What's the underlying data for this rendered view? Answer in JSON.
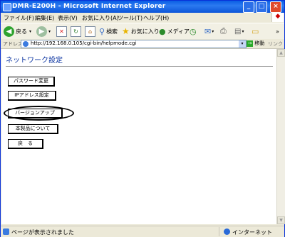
{
  "window": {
    "title": "DMR-E200H - Microsoft Internet Explorer"
  },
  "menu": [
    "ファイル(F)",
    "編集(E)",
    "表示(V)",
    "お気に入り(A)",
    "ツール(T)",
    "ヘルプ(H)"
  ],
  "toolbar": {
    "back": "戻る",
    "search": "検索",
    "favorites": "お気に入り",
    "media": "メディア"
  },
  "address": {
    "label": "アドレス(D)",
    "url": "http://192.168.0.105/cgi-bin/helpmode.cgi",
    "go": "移動",
    "links": "リンク"
  },
  "page": {
    "title": "ネットワーク設定",
    "buttons": [
      "パスワード変更",
      "IPアドレス設定",
      "バージョンアップ",
      "本製品について",
      "戻　る"
    ]
  },
  "status": {
    "text": "ページが表示されました",
    "zone": "インターネット"
  }
}
